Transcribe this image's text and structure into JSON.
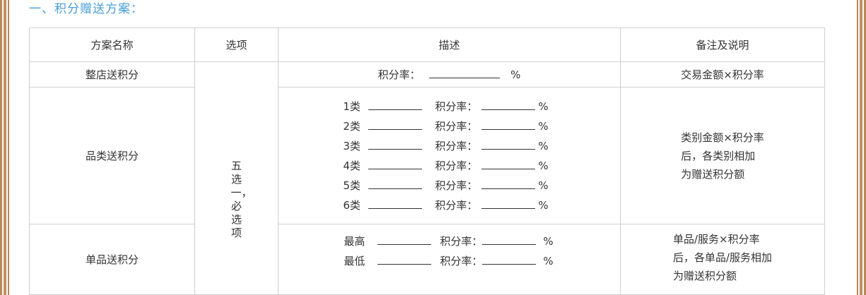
{
  "section_title": "一、积分赠送方案：",
  "table": {
    "headers": [
      "方案名称",
      "选项",
      "描述",
      "备注及说明"
    ],
    "option_text": "五选一，必选项",
    "rows": {
      "shop": {
        "name": "整店送积分",
        "rate_label": "积分率：",
        "pct": "%",
        "note": "交易金额×积分率"
      },
      "category": {
        "name": "品类送积分",
        "items": [
          {
            "label": "1类",
            "rate_label": "积分率：",
            "pct": "%"
          },
          {
            "label": "2类",
            "rate_label": "积分率：",
            "pct": "%"
          },
          {
            "label": "3类",
            "rate_label": "积分率：",
            "pct": "%"
          },
          {
            "label": "4类",
            "rate_label": "积分率：",
            "pct": "%"
          },
          {
            "label": "5类",
            "rate_label": "积分率：",
            "pct": "%"
          },
          {
            "label": "6类",
            "rate_label": "积分率：",
            "pct": "%"
          }
        ],
        "note_lines": [
          "类别金额×积分率",
          "后，各类别相加",
          "为赠送积分额"
        ]
      },
      "single": {
        "name": "单品送积分",
        "items": [
          {
            "label": "最高",
            "rate_label": "积分率：",
            "pct": "%"
          },
          {
            "label": "最低",
            "rate_label": "积分率：",
            "pct": "%"
          }
        ],
        "note_lines": [
          "单品/服务×积分率",
          "后，各单品/服务相加",
          "为赠送积分额"
        ]
      }
    }
  }
}
